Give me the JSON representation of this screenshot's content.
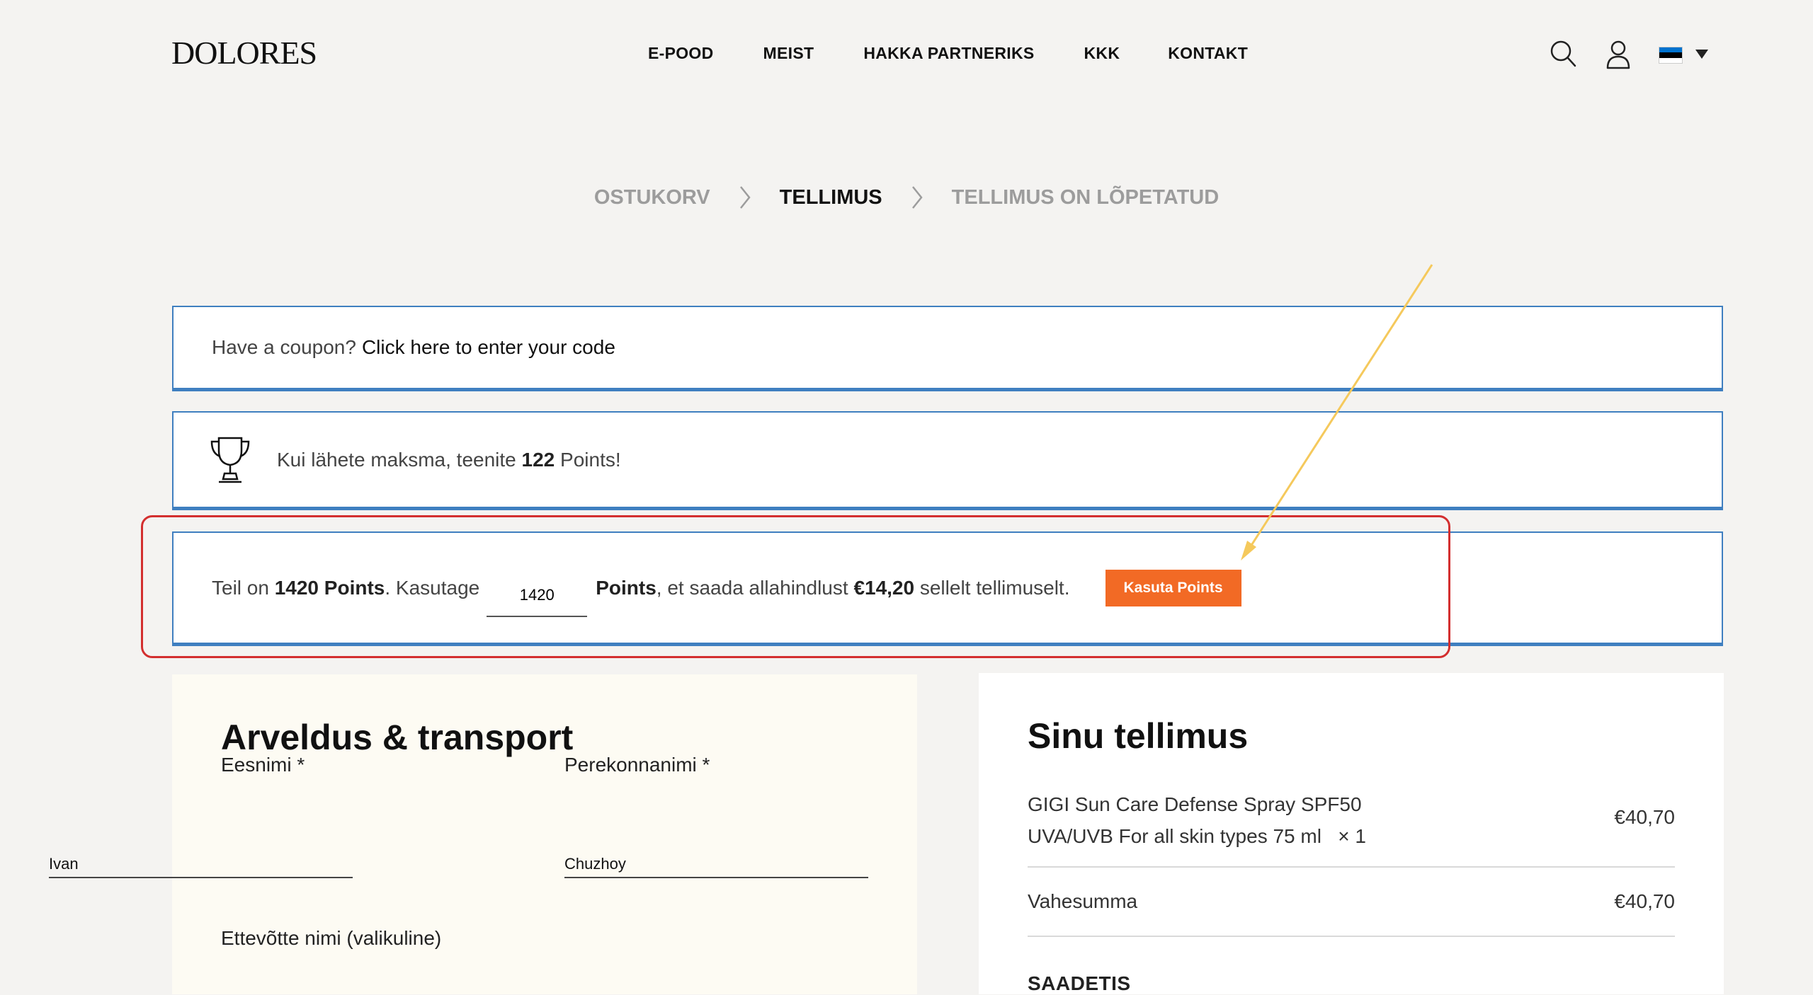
{
  "brand": {
    "logo": "DOLORES"
  },
  "nav": [
    "E-POOD",
    "MEIST",
    "HAKKA PARTNERIKS",
    "KKK",
    "KONTAKT"
  ],
  "header_icons": [
    "search-icon",
    "user-icon",
    "estonian-flag-icon",
    "chevron-down-icon"
  ],
  "flag_colors": [
    "#0072ce",
    "#000000",
    "#ffffff"
  ],
  "steps": [
    {
      "label": "OSTUKORV",
      "state": "done"
    },
    {
      "label": "TELLIMUS",
      "state": "active"
    },
    {
      "label": "TELLIMUS ON LÕPETATUD",
      "state": "upcoming"
    }
  ],
  "coupon": {
    "prompt": "Have a coupon?",
    "link": "Click here to enter your code"
  },
  "reward": {
    "prefix": "Kui lähete maksma, teenite",
    "points": "122",
    "suffix": "Points!"
  },
  "points_redeem": {
    "prefix": "Teil on",
    "balance": "1420",
    "balance_unit": "Points",
    "use_text": ". Kasutage",
    "input_value": "1420",
    "unit": "Points",
    "mid_text": ", et saada allahindlust",
    "discount": "€14,20",
    "suffix": "sellelt tellimuselt.",
    "button": "Kasuta Points"
  },
  "colors": {
    "accent_orange": "#f26a25",
    "notice_border": "#3f7fc0",
    "highlight_red": "#d32f2f",
    "arrow_yellow": "#f5c95c"
  },
  "billing": {
    "title": "Arveldus & transport",
    "first_name_label": "Eesnimi *",
    "first_name_value": "Ivan",
    "last_name_label": "Perekonnanimi *",
    "last_name_value": "Chuzhoy",
    "company_label": "Ettevõtte nimi (valikuline)"
  },
  "order": {
    "title": "Sinu tellimus",
    "item_line1": "GIGI Sun Care Defense Spray SPF50",
    "item_line2": "UVA/UVB For all skin types 75 ml",
    "item_qty": "× 1",
    "item_price": "€40,70",
    "subtotal_label": "Vahesumma",
    "subtotal_value": "€40,70",
    "shipping_label": "SAADETIS"
  }
}
